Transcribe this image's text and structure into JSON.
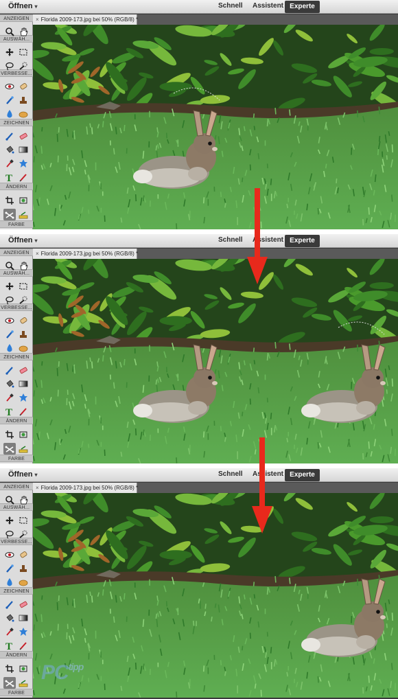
{
  "menu": {
    "open_label": "Öffnen",
    "open_caret": "▾"
  },
  "modes": {
    "quick": "Schnell",
    "guided": "Assistent",
    "expert": "Experte"
  },
  "document_tab": {
    "close": "×",
    "title": "Florida 2009-173.jpg bei 50% (RGB/8) *"
  },
  "toolbox": {
    "sections": [
      "ANZEIGEN",
      "AUSWÄH...",
      "VERBESSE...",
      "ZEICHNEN",
      "ÄNDERN",
      "FARBE"
    ]
  },
  "icons": {
    "zoom": "magnifier-icon",
    "hand": "hand-icon",
    "move": "move-icon",
    "marquee": "marquee-icon",
    "lasso": "lasso-icon",
    "quick-select": "quick-selection-icon",
    "red-eye": "red-eye-icon",
    "spot-heal": "spot-healing-icon",
    "smart-brush": "smart-brush-icon",
    "clone": "clone-stamp-icon",
    "blur": "blur-icon",
    "sponge": "sponge-icon",
    "brush": "brush-icon",
    "eraser": "eraser-icon",
    "bucket": "paint-bucket-icon",
    "gradient": "gradient-icon",
    "eyedropper": "eyedropper-icon",
    "shape": "custom-shape-icon",
    "type": "type-icon",
    "pencil": "pencil-icon",
    "crop": "crop-icon",
    "recompose": "recompose-icon",
    "content-move": "content-aware-move-icon",
    "straighten": "straighten-icon"
  },
  "colors": {
    "arrow": "#e8291c",
    "grass": "#4f9a45",
    "foliage": "#2f6a22",
    "expert_bg": "#3a3a3a"
  },
  "watermark": {
    "main": "PC",
    "small": "tipp"
  }
}
